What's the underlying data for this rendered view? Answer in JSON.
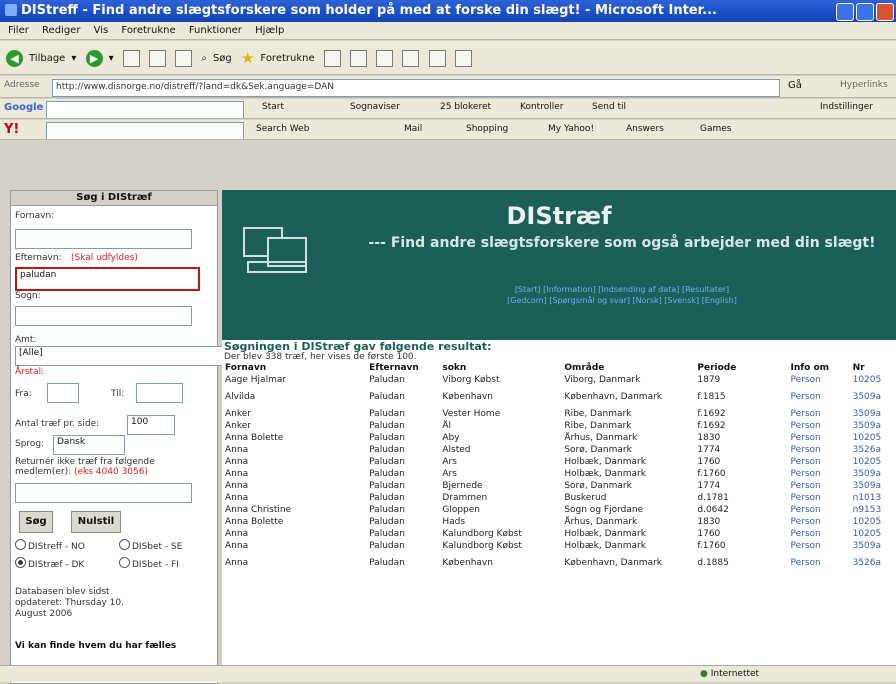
{
  "window": {
    "title": "DIStreff - Find andre slægtsforskere som holder på med at forske din slægt! - Microsoft Inter..."
  },
  "menu": [
    "Filer",
    "Rediger",
    "Vis",
    "Foretrukne",
    "Funktioner",
    "Hjælp"
  ],
  "toolbar": {
    "back_label": "Tilbage",
    "search_label": "Søg",
    "favorites_label": "Foretrukne"
  },
  "address": {
    "label": "Adresse",
    "url": "http://www.disnorge.no/distreff/?land=dk&Sek.anguage=DAN",
    "go_label": "Gå",
    "links_label": "Hyperlinks"
  },
  "google_bar": {
    "brand": "Google",
    "items": [
      "Start",
      "Sognaviser",
      "25 blokeret",
      "Kontroller",
      "Send til"
    ],
    "settings": "Indstillinger"
  },
  "yahoo_bar": {
    "brand": "Y!",
    "items": [
      "Search Web",
      "Mail",
      "Shopping",
      "My Yahoo!",
      "Answers",
      "Games"
    ]
  },
  "search_panel": {
    "title": "Søg i DIStræf",
    "fornavn_label": "Fornavn:",
    "efternavn_label": "Efternavn:",
    "efternavn_hint": "(Skal udfyldes)",
    "efternavn_value": "paludan",
    "sogn_label": "Sogn:",
    "amt_label": "Amt:",
    "amt_value": "[Alle]",
    "aarstal_label": "Årstal:",
    "fra_label": "Fra:",
    "til_label": "Til:",
    "antal_label": "Antal træf pr. side:",
    "antal_value": "100",
    "sprog_label": "Sprog:",
    "sprog_value": "Dansk",
    "returner_text": "Returnér ikke træf fra følgende medlem(er):",
    "returner_hint": "(eks 4040 3056)",
    "search_button": "Søg",
    "reset_button": "Nulstil",
    "radios": [
      "DIStreff - NO",
      "DISbet - SE",
      "DIStræf - DK",
      "DISbet - FI"
    ],
    "db_updated": "Databasen blev sidst opdateret: Thursday 10. August 2006",
    "footer_title": "Vi kan finde hvem du har fælles"
  },
  "banner": {
    "title": "DIStræf",
    "subtitle": "--- Find andre slægtsforskere som også arbejder med din slægt!",
    "links_line1": "[Start] [Information] [Indsending af data] [Resultater]",
    "links_line2": "[Gedcom] [Spørgsmål og svar] [Norsk] [Svensk] [English]"
  },
  "results": {
    "heading": "Søgningen i DIStræf gav følgende resultat:",
    "summary": "Der blev 338 træf, her vises de første 100.",
    "columns": [
      "Fornavn",
      "Efternavn",
      "sokn",
      "Område",
      "Periode",
      "Info om",
      "Nr"
    ],
    "rows": [
      [
        "Aage Hjalmar",
        "Paludan",
        "Viborg Købst",
        "Viborg, Danmark",
        "1879",
        "Person",
        "10205"
      ],
      [
        "Alvilda",
        "Paludan",
        "København",
        "København, Danmark",
        "f.1815",
        "Person",
        "3509a"
      ],
      [
        "Anker",
        "Paludan",
        "Vester Home",
        "Ribe, Danmark",
        "f.1692",
        "Person",
        "3509a"
      ],
      [
        "Anker",
        "Paludan",
        "Ål",
        "Ribe, Danmark",
        "f.1692",
        "Person",
        "3509a"
      ],
      [
        "Anna Bolette",
        "Paludan",
        "Aby",
        "Århus, Danmark",
        "1830",
        "Person",
        "10205"
      ],
      [
        "Anna",
        "Paludan",
        "Alsted",
        "Sorø, Danmark",
        "1774",
        "Person",
        "3526a"
      ],
      [
        "Anna",
        "Paludan",
        "Ars",
        "Holbæk, Danmark",
        "1760",
        "Person",
        "10205"
      ],
      [
        "Anna",
        "Paludan",
        "Ars",
        "Holbæk, Danmark",
        "f.1760",
        "Person",
        "3509a"
      ],
      [
        "Anna",
        "Paludan",
        "Bjernede",
        "Sorø, Danmark",
        "1774",
        "Person",
        "3509a"
      ],
      [
        "Anna",
        "Paludan",
        "Drammen",
        "Buskerud",
        "d.1781",
        "Person",
        "n1013"
      ],
      [
        "Anna Christine",
        "Paludan",
        "Gloppen",
        "Sogn og Fjordane",
        "d.0642",
        "Person",
        "n9153"
      ],
      [
        "Anna Bolette",
        "Paludan",
        "Hads",
        "Århus, Danmark",
        "1830",
        "Person",
        "10205"
      ],
      [
        "Anna",
        "Paludan",
        "Kalundborg Købst",
        "Holbæk, Danmark",
        "1760",
        "Person",
        "10205"
      ],
      [
        "Anna",
        "Paludan",
        "Kalundborg Købst",
        "Holbæk, Danmark",
        "f.1760",
        "Person",
        "3509a"
      ],
      [
        "Anna",
        "Paludan",
        "København",
        "København, Danmark",
        "d.1885",
        "Person",
        "3526a"
      ]
    ]
  },
  "status": {
    "zone": "Internettet"
  }
}
